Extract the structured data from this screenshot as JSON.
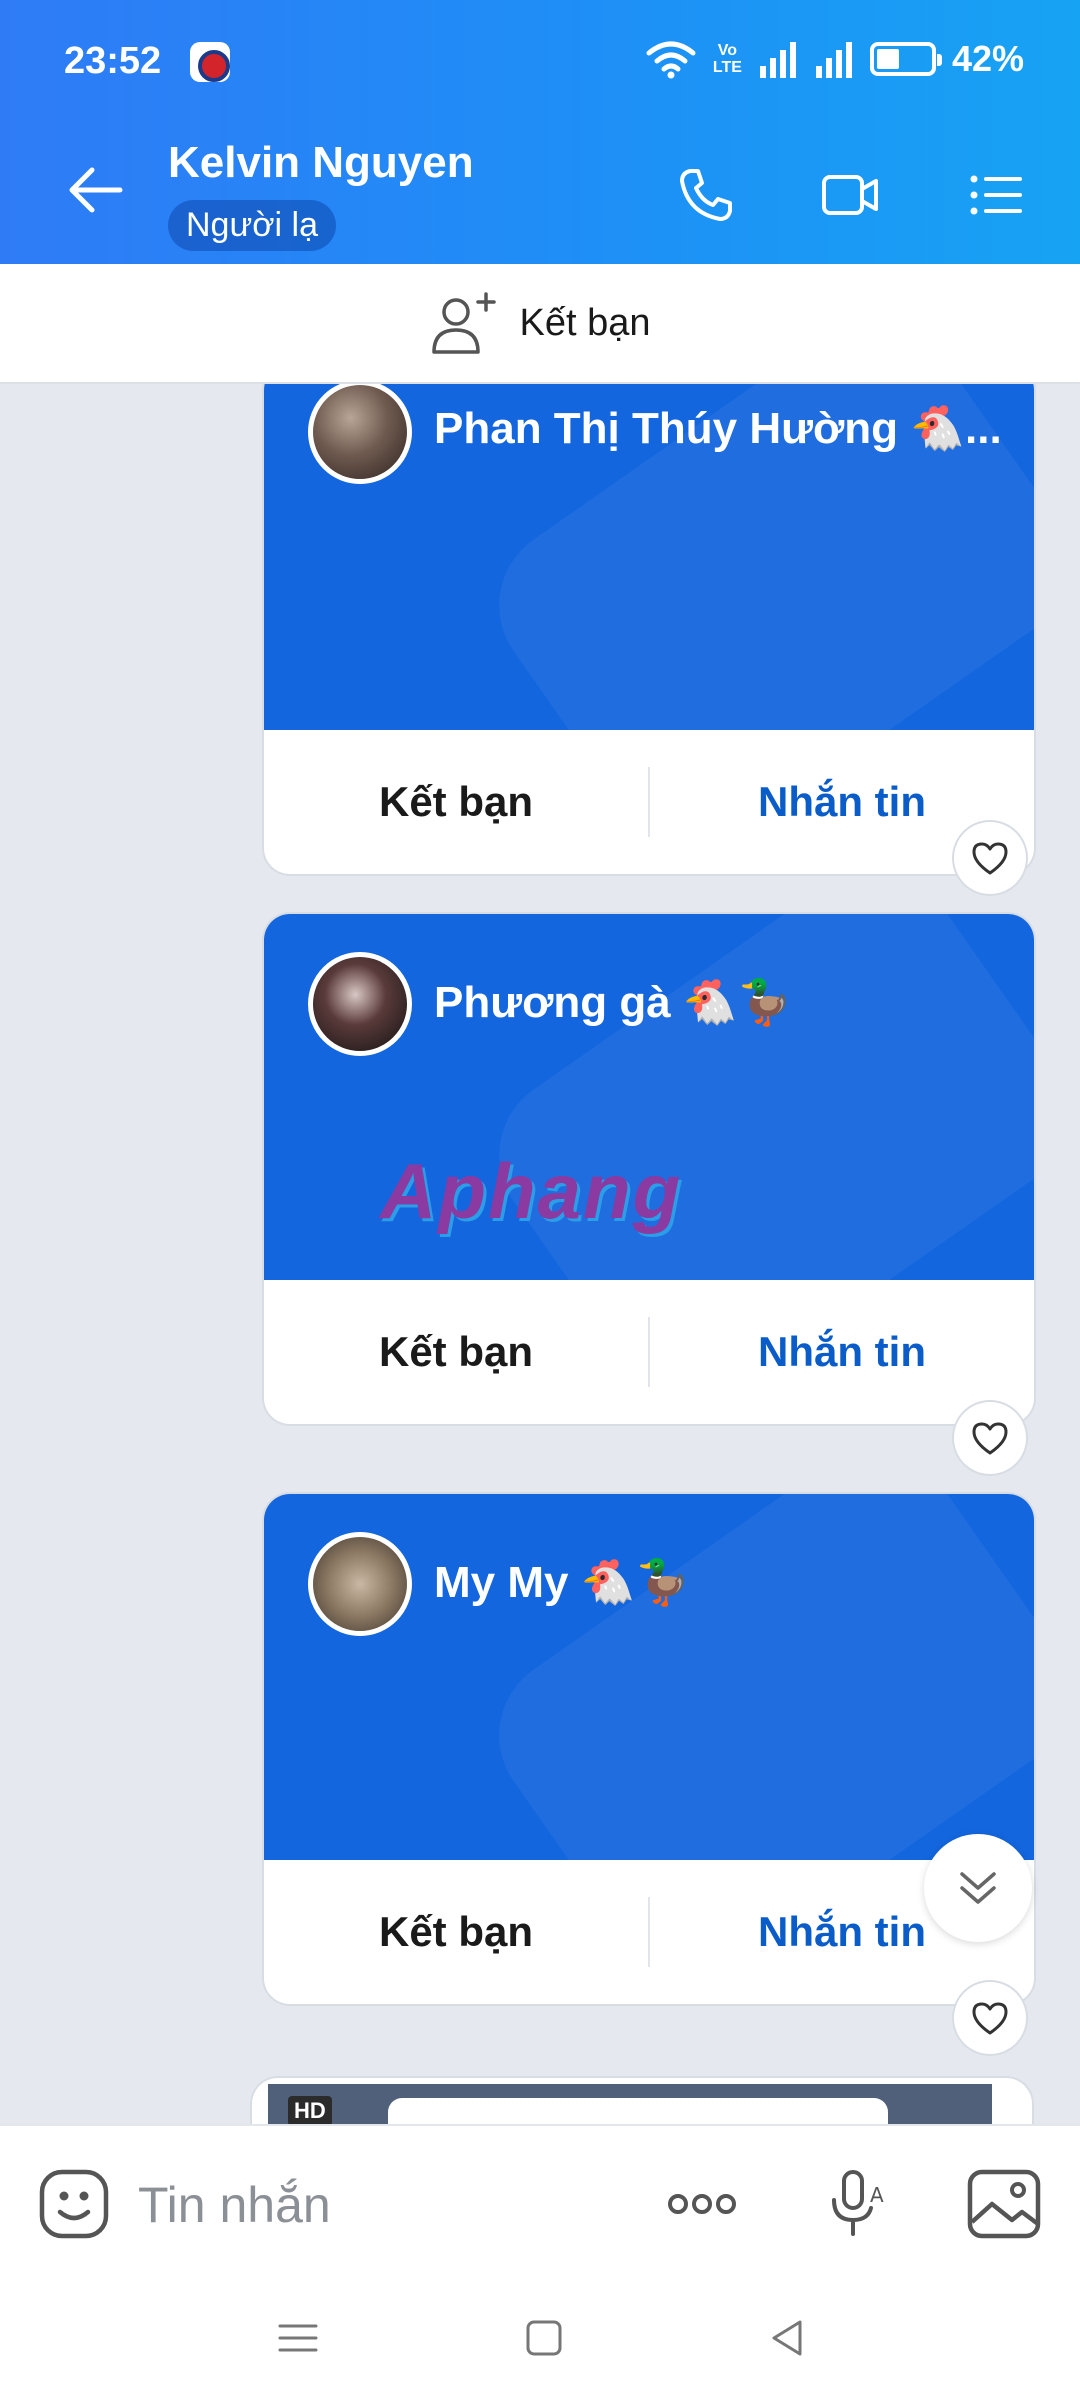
{
  "status_bar": {
    "time": "23:52",
    "network_top": "Vo",
    "network_bottom": "LTE",
    "battery": "42%"
  },
  "header": {
    "title": "Kelvin Nguyen",
    "subtitle": "Người lạ"
  },
  "add_friend_bar": {
    "label": "Kết bạn"
  },
  "cards": [
    {
      "name": "Phan Thị Thúy Hường 🐔...",
      "add_label": "Kết bạn",
      "message_label": "Nhắn tin"
    },
    {
      "name": "Phương gà 🐔🦆",
      "add_label": "Kết bạn",
      "message_label": "Nhắn tin",
      "watermark": "Aphang"
    },
    {
      "name": "My My 🐔🦆",
      "add_label": "Kết bạn",
      "message_label": "Nhắn tin"
    }
  ],
  "peek_card": {
    "badge": "HD"
  },
  "input": {
    "placeholder": "Tin nhắn"
  },
  "colors": {
    "header_start": "#2f7bf6",
    "header_end": "#17a3f4",
    "card_blue": "#1366de",
    "action_blue": "#0a5cc9",
    "background": "#e5e9ef"
  }
}
